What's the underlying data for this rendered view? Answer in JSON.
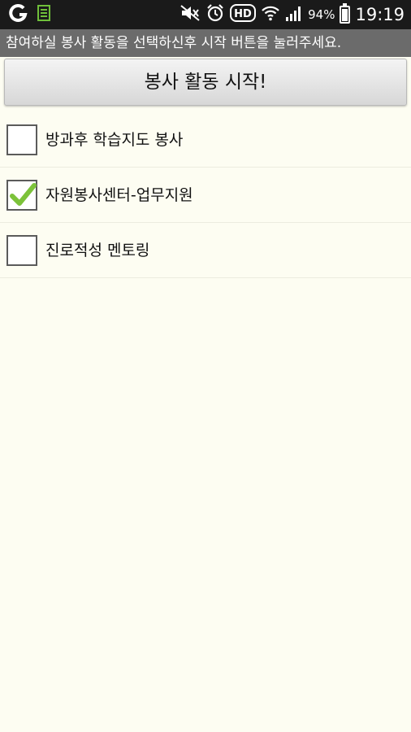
{
  "status_bar": {
    "battery_percent": "94%",
    "battery_level": 0.94,
    "time": "19:19",
    "icons_left": [
      "carrier-logo-icon",
      "sim-card-icon"
    ],
    "icons_right": [
      "mute-icon",
      "alarm-icon",
      "hd-voice-icon",
      "wifi-icon",
      "signal-icon",
      "battery-icon"
    ]
  },
  "title_bar": {
    "text": "참여하실 봉사 활동을 선택하신후 시작 버튼을 눌러주세요."
  },
  "start_button": {
    "label": "봉사 활동 시작!"
  },
  "activities": [
    {
      "label": "방과후 학습지도 봉사",
      "checked": false
    },
    {
      "label": "자원봉사센터-업무지원",
      "checked": true
    },
    {
      "label": "진로적성 멘토링",
      "checked": false
    }
  ],
  "colors": {
    "background": "#fdfdf2",
    "title_bar": "#6b6b6b",
    "check_mark": "#7cc23a"
  }
}
